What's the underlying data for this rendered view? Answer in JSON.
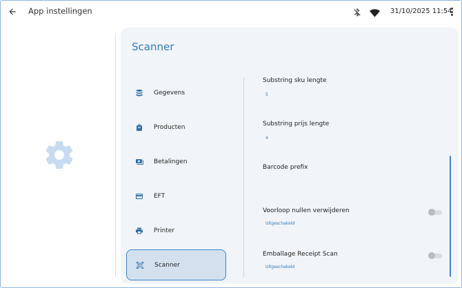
{
  "header": {
    "title": "App instellingen",
    "back_icon": "arrow-left-icon",
    "status_icons": [
      "bluetooth-disabled-icon",
      "wifi-icon"
    ],
    "datetime": "31/10/2025 11:54",
    "menu_icon": "more-vert-icon"
  },
  "card": {
    "title": "Scanner"
  },
  "nav": {
    "items": [
      {
        "label": "Gegevens",
        "icon": "database-icon"
      },
      {
        "label": "Producten",
        "icon": "shopping-bag-icon"
      },
      {
        "label": "Betalingen",
        "icon": "payments-icon"
      },
      {
        "label": "EFT",
        "icon": "credit-card-icon"
      },
      {
        "label": "Printer",
        "icon": "printer-icon"
      },
      {
        "label": "Scanner",
        "icon": "qr-code-scanner-icon",
        "selected": true
      }
    ]
  },
  "settings": [
    {
      "label": "Substring sku lengte",
      "value": "5"
    },
    {
      "label": "Substring prijs lengte",
      "value": "4"
    },
    {
      "label": "Barcode prefix",
      "value": ""
    },
    {
      "label": "Voorloop nullen verwijderen",
      "value": "Uitgeschakeld",
      "toggle": false
    },
    {
      "label": "Emballage Receipt Scan",
      "value": "Uitgeschakeld",
      "toggle": false
    }
  ],
  "colors": {
    "accent": "#2f7ab8",
    "selected_bg": "#d3e1ee",
    "card_bg": "#f1f4f8",
    "gear": "#c7dcee"
  }
}
